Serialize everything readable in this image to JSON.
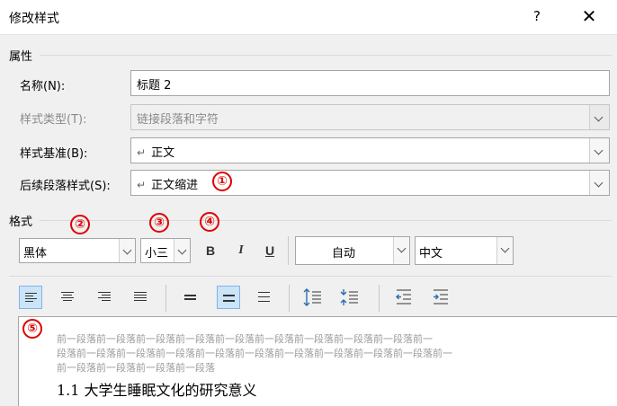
{
  "dialog": {
    "title": "修改样式",
    "help_label": "?",
    "close_label": "✕"
  },
  "properties": {
    "section_label": "属性",
    "name_label": "名称(N):",
    "name_value": "标题 2",
    "style_type_label": "样式类型(T):",
    "style_type_value": "链接段落和字符",
    "style_based_label": "样式基准(B):",
    "style_based_value": "正文",
    "next_para_label": "后续段落样式(S):",
    "next_para_value": "正文缩进",
    "paragraph_mark": "↵"
  },
  "format": {
    "section_label": "格式",
    "font_name": "黑体",
    "font_size": "小三",
    "bold_label": "B",
    "italic_label": "I",
    "underline_label": "U",
    "color_value": "自动",
    "script_value": "中文"
  },
  "callouts": [
    "①",
    "②",
    "③",
    "④",
    "⑤"
  ],
  "preview": {
    "prev_lines": [
      "前一段落前一段落前一段落前一段落前一段落前一段落前一段落前一段落前一段落前一",
      "段落前一段落前一段落前一段落前一段落前一段落前一段落前一段落前一段落前一段落前一",
      "前一段落前一段落前一段落前一段落"
    ],
    "heading_text": "1.1 大学生睡眠文化的研究意义"
  },
  "icons": {
    "align_left": "align-left-icon",
    "align_center": "align-center-icon",
    "align_right": "align-right-icon",
    "align_justify": "align-justify-icon",
    "single_spacing": "single-spacing-icon",
    "one_half_spacing": "one-half-spacing-icon",
    "double_spacing": "double-spacing-icon",
    "increase_para_spacing": "increase-paragraph-spacing-icon",
    "decrease_para_spacing": "decrease-paragraph-spacing-icon",
    "decrease_indent": "decrease-indent-icon",
    "increase_indent": "increase-indent-icon"
  },
  "colors": {
    "callout_red": "#e00000",
    "active_button_bg": "#cce4f7",
    "indent_icon_blue": "#2b6cb0"
  }
}
